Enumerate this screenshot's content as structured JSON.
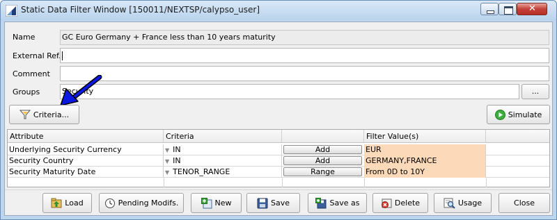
{
  "window": {
    "title": "Static Data Filter Window  [150011/NEXTSP/calypso_user]"
  },
  "form": {
    "name_label": "Name",
    "name_value": "GC Euro Germany + France less than 10 years maturity",
    "external_ref_label": "External Ref.",
    "external_ref_value": "",
    "comment_label": "Comment",
    "comment_value": "",
    "groups_label": "Groups",
    "groups_value": "Security",
    "groups_browse_label": "..."
  },
  "toolbar": {
    "criteria_label": "Criteria...",
    "simulate_label": "Simulate"
  },
  "table": {
    "columns": [
      "Attribute",
      "Criteria",
      "",
      "Filter Value(s)",
      ""
    ],
    "rows": [
      {
        "attribute": "Underlying Security Currency",
        "criteria": "IN",
        "action": "Add",
        "value": "EUR"
      },
      {
        "attribute": "Security Country",
        "criteria": "IN",
        "action": "Add",
        "value": "GERMANY,FRANCE"
      },
      {
        "attribute": "Security Maturity Date",
        "criteria": "TENOR_RANGE",
        "action": "Range",
        "value": "From 0D to 10Y"
      }
    ]
  },
  "actions": {
    "load": "Load",
    "pending": "Pending Modifs.",
    "new": "New",
    "save": "Save",
    "save_as": "Save as",
    "delete": "Delete",
    "usage": "Usage",
    "close": "Close"
  },
  "colors": {
    "value_cell": "#fcd9b8",
    "annotation_arrow": "#0a18e0"
  }
}
